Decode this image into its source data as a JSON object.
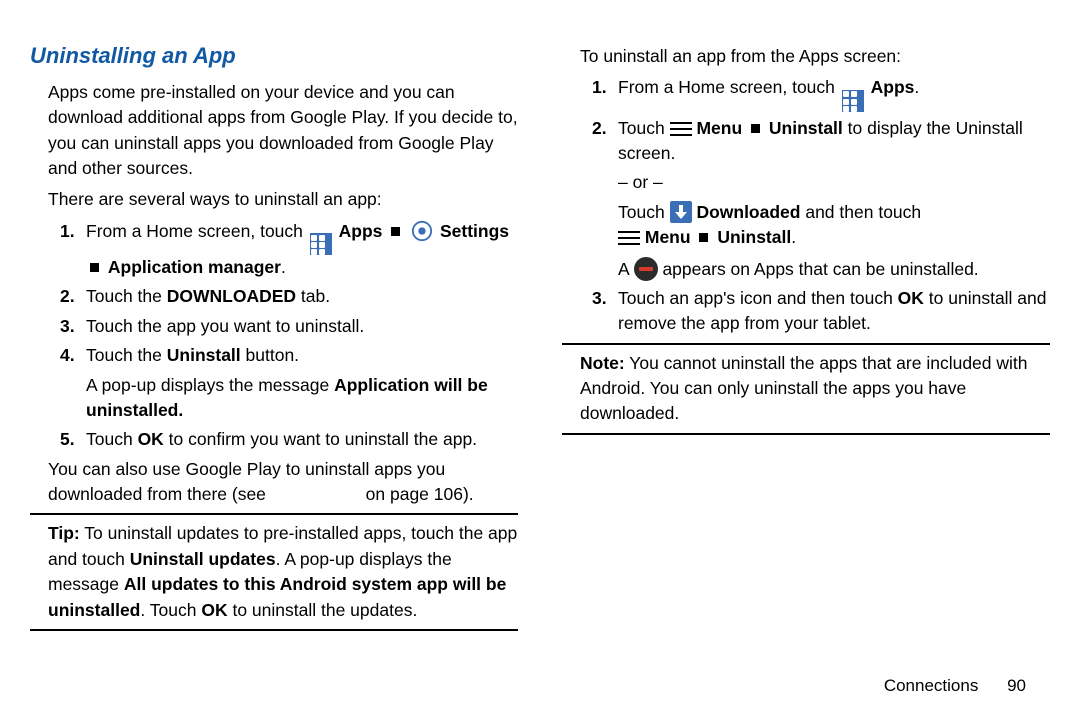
{
  "heading": "Uninstalling an App",
  "left": {
    "intro": "Apps come pre-installed on your device and you can download additional apps from Google Play. If you decide to, you can uninstall apps you downloaded from Google Play and other sources.",
    "intro2": "There are several ways to uninstall an app:",
    "step1_a": "From a Home screen, touch ",
    "apps_label": " Apps ",
    "settings_label": " Settings",
    "step1_b": "Application manager",
    "step2_a": "Touch the ",
    "step2_b": "DOWNLOADED",
    "step2_c": " tab.",
    "step3": "Touch the app you want to uninstall.",
    "step4_a": "Touch the ",
    "step4_b": "Uninstall",
    "step4_c": " button.",
    "step4_note_a": "A pop-up displays the message ",
    "step4_note_b": "Application will be uninstalled.",
    "step5_a": "Touch ",
    "step5_b": "OK",
    "step5_c": " to confirm you want to uninstall the app.",
    "gplay_a": "You can also use Google Play to uninstall apps you downloaded from there (see ",
    "gplay_b": " on page 106).",
    "tip_label": "Tip:",
    "tip_a": " To uninstall updates to pre-installed apps, touch the app and touch ",
    "tip_b": "Uninstall updates",
    "tip_c": ". A pop-up displays the message ",
    "tip_d": "All updates to this Android system app will be uninstalled",
    "tip_e": ". Touch ",
    "tip_f": "OK",
    "tip_g": " to uninstall the updates."
  },
  "right": {
    "intro": "To uninstall an app from the Apps screen:",
    "step1_a": "From a Home screen, touch ",
    "apps_label": " Apps",
    "step2_a": "Touch ",
    "menu_label": " Menu ",
    "uninstall_label": " Uninstall",
    "step2_b": " to display the Uninstall screen.",
    "or": "– or –",
    "alt_a": "Touch ",
    "downloaded_label": " Downloaded",
    "alt_b": " and then touch",
    "menu_label2": " Menu ",
    "uninstall_label2": " Uninstall",
    "appears_a": "A ",
    "appears_b": " appears on Apps that can be uninstalled.",
    "step3_a": "Touch an app's icon and then touch ",
    "step3_b": "OK",
    "step3_c": " to uninstall and remove the app from your tablet.",
    "note_label": "Note:",
    "note_a": " You cannot uninstall the apps that are included with Android. You can only uninstall the apps you have downloaded."
  },
  "footer": {
    "section": "Connections",
    "page": "90"
  },
  "nums": {
    "n1": "1.",
    "n2": "2.",
    "n3": "3.",
    "n4": "4.",
    "n5": "5."
  },
  "punct": {
    "period": ".",
    "dot": "."
  }
}
